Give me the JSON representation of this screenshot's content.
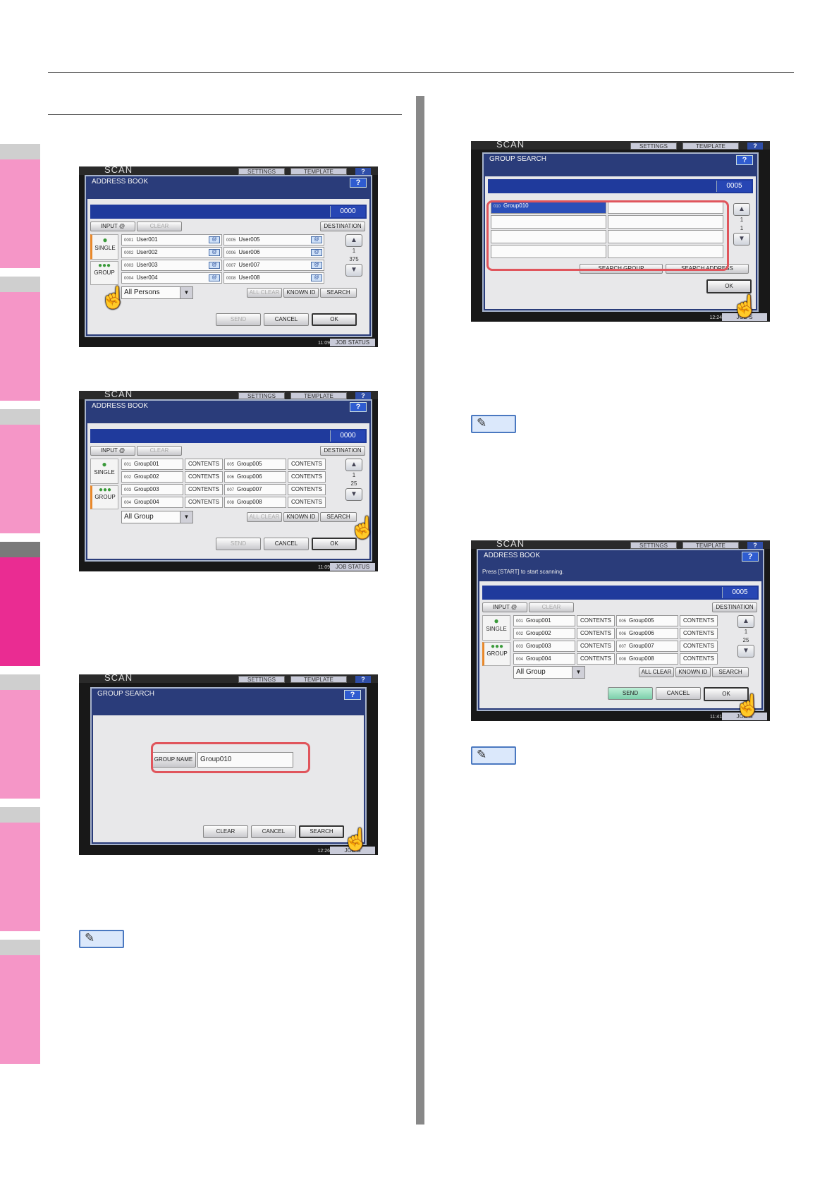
{
  "side_tabs": [
    {
      "state": "normal"
    },
    {
      "state": "normal"
    },
    {
      "state": "normal"
    },
    {
      "state": "active"
    },
    {
      "state": "normal"
    },
    {
      "state": "normal"
    },
    {
      "state": "normal"
    }
  ],
  "common": {
    "scan": "SCAN",
    "settings": "SETTINGS",
    "template": "TEMPLATE",
    "help": "?",
    "input_at": "INPUT @",
    "clear": "CLEAR",
    "destination": "DESTINATION",
    "single": "SINGLE",
    "group": "GROUP",
    "all_clear": "ALL CLEAR",
    "known_id": "KNOWN ID",
    "search": "SEARCH",
    "send": "SEND",
    "cancel": "CANCEL",
    "ok": "OK",
    "job_status": "JOB STATUS",
    "job_status_short": "JOB S",
    "contents": "CONTENTS",
    "up": "▲",
    "down": "▼",
    "icon": "@",
    "dd": "▼"
  },
  "screen1": {
    "title": "ADDRESS BOOK",
    "count": "0000",
    "users_left": [
      {
        "id": "0001",
        "name": "User001"
      },
      {
        "id": "0002",
        "name": "User002"
      },
      {
        "id": "0003",
        "name": "User003"
      },
      {
        "id": "0004",
        "name": "User004"
      }
    ],
    "users_right": [
      {
        "id": "0005",
        "name": "User005"
      },
      {
        "id": "0006",
        "name": "User006"
      },
      {
        "id": "0007",
        "name": "User007"
      },
      {
        "id": "0008",
        "name": "User008"
      }
    ],
    "page_current": "1",
    "page_total": "375",
    "filter": "All Persons",
    "time": "11:09"
  },
  "screen2": {
    "title": "ADDRESS BOOK",
    "count": "0000",
    "groups_left": [
      {
        "id": "001",
        "name": "Group001"
      },
      {
        "id": "002",
        "name": "Group002"
      },
      {
        "id": "003",
        "name": "Group003"
      },
      {
        "id": "004",
        "name": "Group004"
      }
    ],
    "groups_right": [
      {
        "id": "005",
        "name": "Group005"
      },
      {
        "id": "006",
        "name": "Group006"
      },
      {
        "id": "007",
        "name": "Group007"
      },
      {
        "id": "008",
        "name": "Group008"
      }
    ],
    "page_current": "1",
    "page_total": "25",
    "filter": "All Group",
    "time": "11:09"
  },
  "screen3": {
    "title": "GROUP SEARCH",
    "group_name_label": "GROUP NAME",
    "group_name_value": "Group010",
    "clear": "CLEAR",
    "cancel": "CANCEL",
    "search": "SEARCH",
    "time": "12:26"
  },
  "screen4": {
    "title": "GROUP SEARCH",
    "count": "0005",
    "result_id": "010",
    "result_name": "Group010",
    "page_current": "1",
    "page_total": "1",
    "search_group": "SEARCH GROUP",
    "search_address": "SEARCH ADDRESS",
    "ok": "OK",
    "time": "12:24"
  },
  "screen5": {
    "title": "ADDRESS BOOK",
    "message": "Press [START] to start scanning.",
    "count": "0005",
    "groups_left": [
      {
        "id": "001",
        "name": "Group001"
      },
      {
        "id": "002",
        "name": "Group002"
      },
      {
        "id": "003",
        "name": "Group003"
      },
      {
        "id": "004",
        "name": "Group004"
      }
    ],
    "groups_right": [
      {
        "id": "005",
        "name": "Group005"
      },
      {
        "id": "006",
        "name": "Group006"
      },
      {
        "id": "007",
        "name": "Group007"
      },
      {
        "id": "008",
        "name": "Group008"
      }
    ],
    "page_current": "1",
    "page_total": "25",
    "filter": "All Group",
    "time": "11:41"
  }
}
